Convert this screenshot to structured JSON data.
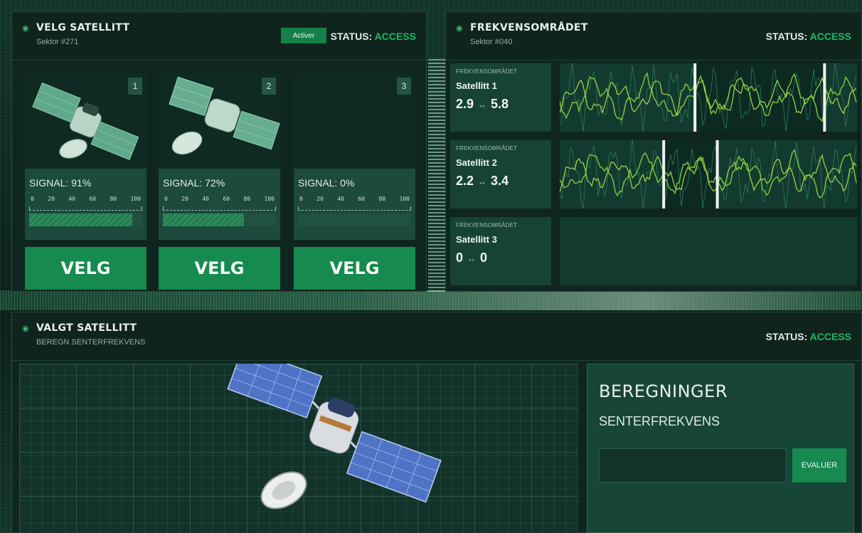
{
  "colors": {
    "accent": "#168a4f",
    "status_ok": "#1fb866",
    "panel": "#0f2620"
  },
  "select_panel": {
    "title": "VELG SATELLITT",
    "subtitle": "Sektor #271",
    "activate_label": "Activer",
    "status_label": "STATUS:",
    "status_value": "ACCESS",
    "cards": [
      {
        "num": "1",
        "signal_label": "SIGNAL: 91%",
        "signal": 91,
        "button": "VELG",
        "image": "satellite-image"
      },
      {
        "num": "2",
        "signal_label": "SIGNAL: 72%",
        "signal": 72,
        "button": "VELG",
        "image": "satellite-image"
      },
      {
        "num": "3",
        "signal_label": "SIGNAL: 0%",
        "signal": 0,
        "button": "VELG",
        "image": ""
      }
    ],
    "scale": [
      "0",
      "20",
      "40",
      "60",
      "80",
      "100"
    ]
  },
  "freq_panel": {
    "title": "FREKVENSOMRÅDET",
    "subtitle": "Sektor #040",
    "status_label": "STATUS:",
    "status_value": "ACCESS",
    "rows": [
      {
        "small": "FREKVENSOMRÅDET",
        "name": "Satellitt 1",
        "low": "2.9",
        "arrow": "↔",
        "high": "5.8",
        "window": [
          2.9,
          5.8
        ],
        "has_wave": true
      },
      {
        "small": "FREKVENSOMRÅDET",
        "name": "Satellitt 2",
        "low": "2.2",
        "arrow": "↔",
        "high": "3.4",
        "window": [
          2.2,
          3.4
        ],
        "has_wave": true
      },
      {
        "small": "FREKVENSOMRÅDET",
        "name": "Satellitt 3",
        "low": "0",
        "arrow": "↔",
        "high": "0",
        "window": [
          0,
          0
        ],
        "has_wave": false
      }
    ]
  },
  "chosen_panel": {
    "title": "VALGT SATELLITT",
    "subtitle": "BEREGN SENTERFREKVENS",
    "status_label": "STATUS:",
    "status_value": "ACCESS",
    "calc_title": "BEREGNINGER",
    "calc_sub": "SENTERFREKVENS",
    "input_value": "",
    "input_placeholder": "",
    "eval_label": "EVALUER"
  }
}
